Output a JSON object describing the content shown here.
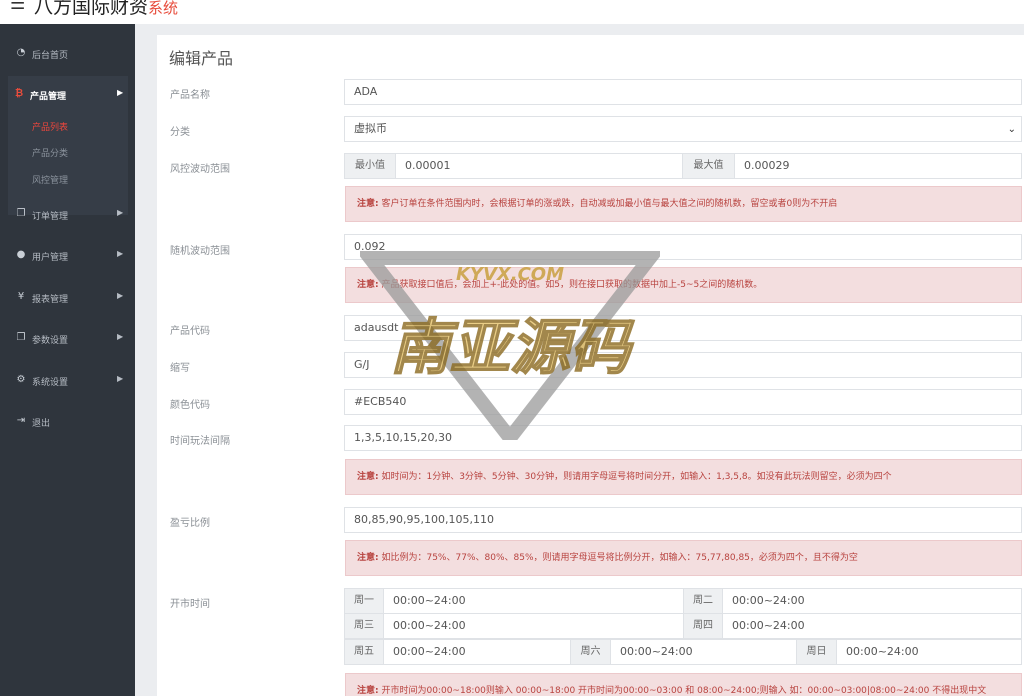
{
  "header": {
    "brand_main": "八方国际财资",
    "brand_sub": "系统",
    "menu_icon": "hamburger-icon"
  },
  "sidebar": {
    "items": [
      {
        "label": "后台首页",
        "icon": "dashboard-icon"
      },
      {
        "label": "订单管理",
        "icon": "copy-icon"
      },
      {
        "label": "用户管理",
        "icon": "user-icon"
      },
      {
        "label": "报表管理",
        "icon": "yen-icon"
      },
      {
        "label": "参数设置",
        "icon": "copy-icon"
      },
      {
        "label": "系统设置",
        "icon": "cogs-icon"
      },
      {
        "label": "退出",
        "icon": "sign-out-icon"
      }
    ],
    "product_group": {
      "label": "产品管理",
      "icon": "bitcoin-icon",
      "subitems": [
        "产品列表",
        "产品分类",
        "风控管理"
      ]
    }
  },
  "form": {
    "title": "编辑产品",
    "name": {
      "label": "产品名称",
      "value": "ADA"
    },
    "category": {
      "label": "分类",
      "value": "虚拟币"
    },
    "risk": {
      "label": "风控波动范围",
      "min_label": "最小值",
      "min_value": "0.00001",
      "max_label": "最大值",
      "max_value": "0.00029",
      "notice_prefix": "注意:",
      "notice": "客户订单在条件范围内时，会根据订单的涨或跌，自动减或加最小值与最大值之间的随机数，留空或者0则为不开启"
    },
    "random": {
      "label": "随机波动范围",
      "value": "0.092",
      "notice_prefix": "注意:",
      "notice": "产品获取接口值后，会加上+-此处的值。如5，则在接口获取的数据中加上-5~5之间的随机数。"
    },
    "code": {
      "label": "产品代码",
      "value": "adausdt"
    },
    "abbr": {
      "label": "缩写",
      "value": "G/J"
    },
    "color": {
      "label": "颜色代码",
      "value": "#ECB540"
    },
    "interval": {
      "label": "时间玩法间隔",
      "value": "1,3,5,10,15,20,30",
      "notice_prefix": "注意:",
      "notice": "如时间为：1分钟、3分钟、5分钟、30分钟，则请用字母逗号将时间分开，如输入：1,3,5,8。如没有此玩法则留空，必须为四个"
    },
    "ratio": {
      "label": "盈亏比例",
      "value": "80,85,90,95,100,105,110",
      "notice_prefix": "注意:",
      "notice": "如比例为：75%、77%、80%、85%，则请用字母逗号将比例分开，如输入：75,77,80,85，必须为四个，且不得为空"
    },
    "opening": {
      "label": "开市时间",
      "days": [
        {
          "day": "周一",
          "time": "00:00~24:00"
        },
        {
          "day": "周二",
          "time": "00:00~24:00"
        },
        {
          "day": "周三",
          "time": "00:00~24:00"
        },
        {
          "day": "周四",
          "time": "00:00~24:00"
        },
        {
          "day": "周五",
          "time": "00:00~24:00"
        },
        {
          "day": "周六",
          "time": "00:00~24:00"
        },
        {
          "day": "周日",
          "time": "00:00~24:00"
        }
      ],
      "notice_prefix": "注意:",
      "notice": "开市时间为00:00~18:00则输入 00:00~18:00 开市时间为00:00~03:00 和 08:00~24:00;则输入 如：00:00~03:00|08:00~24:00 不得出现中文"
    }
  },
  "watermark": {
    "top": "KYVX.COM",
    "main": "南亚源码"
  },
  "colors": {
    "sidebar_bg": "#2f353d",
    "accent": "#f0463c",
    "notice_bg": "#f3dedf",
    "notice_text": "#b8433f"
  }
}
